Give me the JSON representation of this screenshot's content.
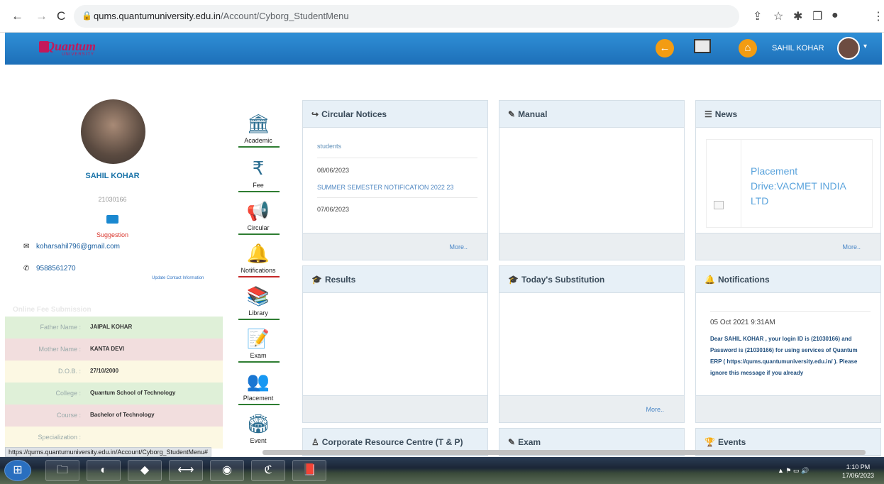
{
  "browser": {
    "url_host": "qums.quantumuniversity.edu.in",
    "url_path": "/Account/Cyborg_StudentMenu",
    "status_url": "https://qums.quantumuniversity.edu.in/Account/Cyborg_StudentMenu#"
  },
  "header": {
    "logo_text": "Quantum",
    "logo_sub": "UNIVERSITY",
    "user_name": "SAHIL KOHAR"
  },
  "profile": {
    "name": "SAHIL KOHAR",
    "id": "21030166",
    "suggestion": "Suggestion",
    "email": "koharsahil796@gmail.com",
    "phone": "9588561270",
    "update_link": "Update Contact Information",
    "fee_link": "Online Fee Submission",
    "rows": [
      {
        "label": "Father Name :",
        "value": "JAIPAL KOHAR",
        "color": "#dff0d8"
      },
      {
        "label": "Mother Name :",
        "value": "KANTA DEVI",
        "color": "#f2dede"
      },
      {
        "label": "D.O.B. :",
        "value": "27/10/2000",
        "color": "#fcf8e3"
      },
      {
        "label": "College :",
        "value": "Quantum School of Technology",
        "color": "#dff0d8"
      },
      {
        "label": "Course :",
        "value": "Bachelor of Technology",
        "color": "#f2dede"
      },
      {
        "label": "Specialization :",
        "value": "",
        "color": "#fcf8e3"
      }
    ]
  },
  "menu": [
    {
      "label": "Academic",
      "icon": "building-icon",
      "glyph": "🏛",
      "bar": "#2e7d32"
    },
    {
      "label": "Fee",
      "icon": "fee-icon",
      "glyph": "₹",
      "bar": "#2e7d32"
    },
    {
      "label": "Circular",
      "icon": "megaphone-icon",
      "glyph": "📢",
      "bar": "#2e7d32"
    },
    {
      "label": "Notifications",
      "icon": "bell-icon",
      "glyph": "🔔",
      "bar": "#c62828"
    },
    {
      "label": "Library",
      "icon": "library-icon",
      "glyph": "📚",
      "bar": "#2e7d32"
    },
    {
      "label": "Exam",
      "icon": "exam-icon",
      "glyph": "📝",
      "bar": "#2e7d32"
    },
    {
      "label": "Placement",
      "icon": "placement-icon",
      "glyph": "👥",
      "bar": "#2e7d32"
    },
    {
      "label": "Event",
      "icon": "event-icon",
      "glyph": "🏟",
      "bar": "#2e7d32"
    }
  ],
  "panels": {
    "circular": {
      "title": "Circular Notices",
      "items": [
        "students",
        "08/06/2023",
        "SUMMER SEMESTER NOTIFICATION 2022 23",
        "07/06/2023"
      ],
      "more": "More.."
    },
    "manual": {
      "title": "Manual"
    },
    "news": {
      "title": "News",
      "item": "Placement Drive:VACMET INDIA LTD",
      "more": "More.."
    },
    "results": {
      "title": "Results"
    },
    "substitution": {
      "title": "Today's Substitution",
      "more": "More.."
    },
    "notifications": {
      "title": "Notifications",
      "date": "05 Oct 2021 9:31AM",
      "message": "Dear SAHIL KOHAR , your login ID is (21030166) and Password is (21030166) for using services of Quantum ERP ( https://qums.quantumuniversity.edu.in/ ). Please ignore this message if you already"
    },
    "corporate": {
      "title": "Corporate Resource Centre (T & P)"
    },
    "exam": {
      "title": "Exam"
    },
    "events": {
      "title": "Events"
    }
  },
  "taskbar": {
    "time": "1:10 PM",
    "date": "17/06/2023"
  }
}
